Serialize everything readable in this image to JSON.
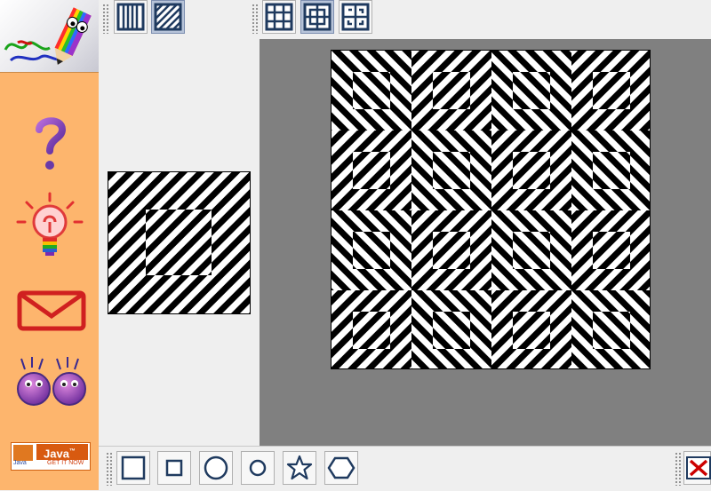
{
  "app": {
    "sidebar": {
      "logo_icon": "pencil-drawing-logo-icon",
      "items": [
        {
          "icon": "question-mark-icon"
        },
        {
          "icon": "lightbulb-icon"
        },
        {
          "icon": "envelope-icon"
        },
        {
          "icon": "googly-eyes-icon"
        }
      ],
      "java_badge": {
        "brand": "Java",
        "tm": "™",
        "sub_left": "Java",
        "sub_right": "GET IT NOW"
      }
    },
    "top_toolbar": {
      "pattern_buttons": [
        {
          "icon": "vertical-stripes-icon",
          "selected": false
        },
        {
          "icon": "diagonal-stripes-icon",
          "selected": true
        }
      ],
      "tiling_buttons": [
        {
          "icon": "grid-tiling-icon",
          "selected": false
        },
        {
          "icon": "mirror-tiling-icon",
          "selected": true
        },
        {
          "icon": "rotate-tiling-icon",
          "selected": false
        }
      ]
    },
    "bottom_toolbar": {
      "shape_buttons": [
        {
          "icon": "large-square-icon"
        },
        {
          "icon": "small-square-icon"
        },
        {
          "icon": "large-circle-icon"
        },
        {
          "icon": "small-circle-icon"
        },
        {
          "icon": "star-icon"
        },
        {
          "icon": "hexagon-icon"
        }
      ],
      "close_icon": "close-icon"
    },
    "colors": {
      "sidebar": "#fdb56d",
      "canvas_bg": "#808080",
      "button_icon": "#1f3a5f",
      "selected_button": "#b7c4d9",
      "close_red": "#cc0000"
    }
  }
}
